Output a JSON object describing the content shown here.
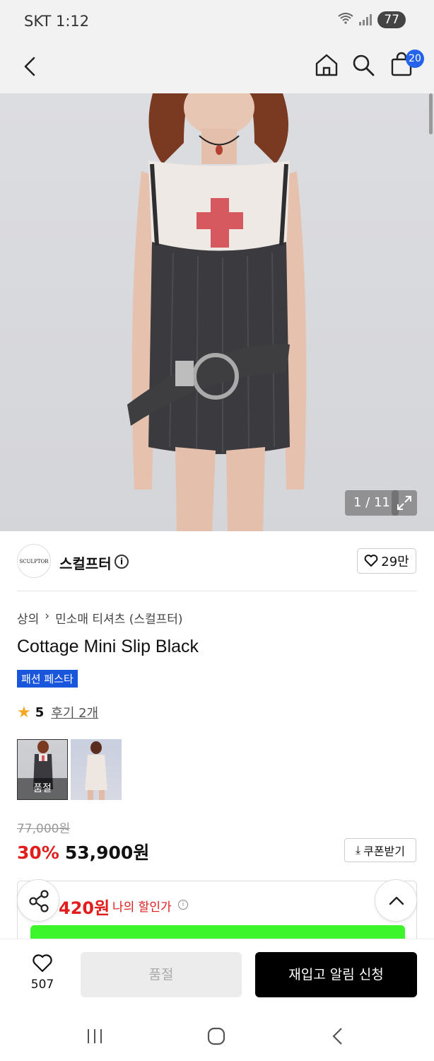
{
  "status": {
    "time": "SKT 1:12",
    "battery": "77"
  },
  "header": {
    "cart_count": "20"
  },
  "hero": {
    "counter": "1 / 11"
  },
  "brand": {
    "name": "스컬프터",
    "logo_text": "SCULPTOR",
    "likes": "29만"
  },
  "breadcrumb": {
    "category": "상의",
    "subcategory": "민소매 티셔츠 (스컬프터)"
  },
  "product": {
    "title": "Cottage Mini Slip Black",
    "tag": "패션 페스타",
    "rating": "5",
    "reviews": "후기 2개",
    "thumb_soldout": "품절",
    "original_price": "77,000원",
    "discount": "30%",
    "price": "53,900원",
    "coupon_label": "쿠폰받기",
    "my_price": "420원",
    "my_price_label": "나의 할인가"
  },
  "bottom": {
    "wish_count": "507",
    "soldout_label": "품절",
    "restock_label": "재입고 알림 신청"
  },
  "colors": {
    "accent": "#1a56db",
    "sale": "#e11d1d",
    "badge": "#2563eb"
  }
}
